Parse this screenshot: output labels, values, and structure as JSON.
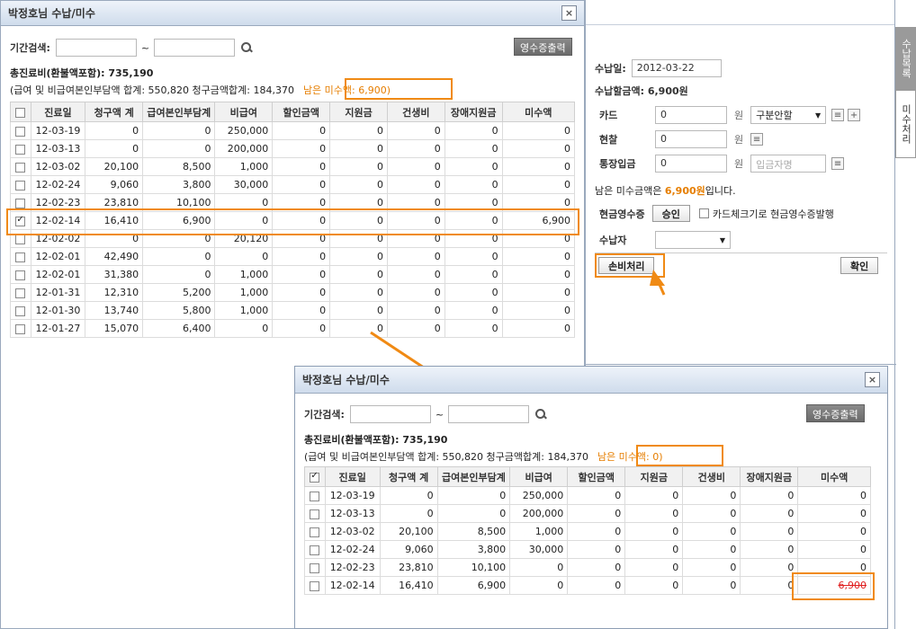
{
  "main_window": {
    "title": "박정호님 수납/미수",
    "close_icon": "×",
    "search_label": "기간검색:",
    "tilde": "~",
    "receipt_button": "영수증출력",
    "total_line": "총진료비(환불액포함): 735,190",
    "sub_line": "(급여 및 비급여본인부담액 합계: 550,820  청구금액합계: 184,370",
    "remaining": "남은 미수액: 6,900)",
    "columns": [
      "진료일",
      "청구액 계",
      "급여본인부담계",
      "비급여",
      "할인금액",
      "지원금",
      "건생비",
      "장애지원금",
      "미수액"
    ],
    "rows": [
      [
        "12-03-19",
        "0",
        "0",
        "250,000",
        "0",
        "0",
        "0",
        "0",
        "0"
      ],
      [
        "12-03-13",
        "0",
        "0",
        "200,000",
        "0",
        "0",
        "0",
        "0",
        "0"
      ],
      [
        "12-03-02",
        "20,100",
        "8,500",
        "1,000",
        "0",
        "0",
        "0",
        "0",
        "0"
      ],
      [
        "12-02-24",
        "9,060",
        "3,800",
        "30,000",
        "0",
        "0",
        "0",
        "0",
        "0"
      ],
      [
        "12-02-23",
        "23,810",
        "10,100",
        "0",
        "0",
        "0",
        "0",
        "0",
        "0"
      ],
      [
        "12-02-14",
        "16,410",
        "6,900",
        "0",
        "0",
        "0",
        "0",
        "0",
        "6,900"
      ],
      [
        "12-02-02",
        "0",
        "0",
        "20,120",
        "0",
        "0",
        "0",
        "0",
        "0"
      ],
      [
        "12-02-01",
        "42,490",
        "0",
        "0",
        "0",
        "0",
        "0",
        "0",
        "0"
      ],
      [
        "12-02-01",
        "31,380",
        "0",
        "1,000",
        "0",
        "0",
        "0",
        "0",
        "0"
      ],
      [
        "12-01-31",
        "12,310",
        "5,200",
        "1,000",
        "0",
        "0",
        "0",
        "0",
        "0"
      ],
      [
        "12-01-30",
        "13,740",
        "5,800",
        "1,000",
        "0",
        "0",
        "0",
        "0",
        "0"
      ],
      [
        "12-01-27",
        "15,070",
        "6,400",
        "0",
        "0",
        "0",
        "0",
        "0",
        "0"
      ]
    ],
    "checked_row": 5
  },
  "right_panel": {
    "date_label": "수납일:",
    "date_value": "2012-03-22",
    "amount_label": "수납할금액: 6,900원",
    "card_label": "카드",
    "card_value": "0",
    "cash_label": "현찰",
    "cash_value": "0",
    "transfer_label": "통장입금",
    "transfer_value": "0",
    "won": "원",
    "installment_select": "구분안할",
    "depositor_placeholder": "입금자명",
    "remaining_pre": "남은 미수금액은 ",
    "remaining_amount": "6,900원",
    "remaining_post": "입니다.",
    "cash_receipt_label": "현금영수증",
    "approve_button": "승인",
    "card_check_label": "카드체크기로 현금영수증발행",
    "payer_label": "수납자",
    "loss_button": "손비처리",
    "confirm_button": "확인",
    "tab_list": "수납목록",
    "tab_unpaid": "미수처리"
  },
  "popup_window": {
    "title": "박정호님 수납/미수",
    "search_label": "기간검색:",
    "tilde": "~",
    "receipt_button": "영수증출력",
    "total_line": "총진료비(환불액포함): 735,190",
    "sub_line": "(급여 및 비급여본인부담액 합계: 550,820  청구금액합계: 184,370",
    "remaining": "남은 미수액: 0)",
    "columns": [
      "진료일",
      "청구액 계",
      "급여본인부담계",
      "비급여",
      "할인금액",
      "지원금",
      "건생비",
      "장애지원금",
      "미수액"
    ],
    "rows": [
      [
        "12-03-19",
        "0",
        "0",
        "250,000",
        "0",
        "0",
        "0",
        "0",
        "0"
      ],
      [
        "12-03-13",
        "0",
        "0",
        "200,000",
        "0",
        "0",
        "0",
        "0",
        "0"
      ],
      [
        "12-03-02",
        "20,100",
        "8,500",
        "1,000",
        "0",
        "0",
        "0",
        "0",
        "0"
      ],
      [
        "12-02-24",
        "9,060",
        "3,800",
        "30,000",
        "0",
        "0",
        "0",
        "0",
        "0"
      ],
      [
        "12-02-23",
        "23,810",
        "10,100",
        "0",
        "0",
        "0",
        "0",
        "0",
        "0"
      ],
      [
        "12-02-14",
        "16,410",
        "6,900",
        "0",
        "0",
        "0",
        "0",
        "0",
        "6,900"
      ]
    ]
  },
  "colors": {
    "accent_orange": "#f08a14",
    "strike_red": "#e02020"
  }
}
